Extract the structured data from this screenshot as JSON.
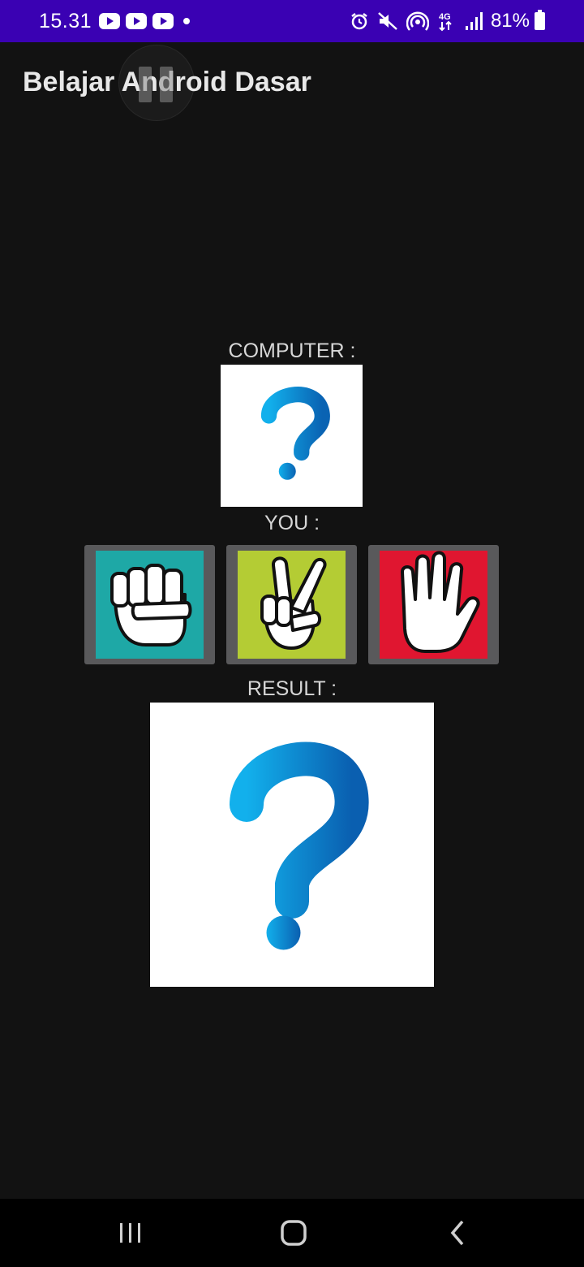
{
  "status_bar": {
    "time": "15.31",
    "notification_icons": [
      "youtube-icon",
      "youtube-icon",
      "youtube-icon"
    ],
    "network_label": "4G",
    "battery": "81%"
  },
  "app_bar": {
    "title": "Belajar Android Dasar"
  },
  "game": {
    "computer_label": "COMPUTER :",
    "computer_choice": "question-mark-icon",
    "you_label": "YOU :",
    "choices": [
      {
        "name": "rock",
        "icon": "fist-icon",
        "bg": "#1ea8a6"
      },
      {
        "name": "scissors",
        "icon": "peace-hand-icon",
        "bg": "#b4cc34"
      },
      {
        "name": "paper",
        "icon": "open-hand-icon",
        "bg": "#e01630"
      }
    ],
    "result_label": "RESULT :",
    "result_image": "question-mark-icon"
  },
  "colors": {
    "status_bar": "#3a01b3",
    "background": "#121212",
    "question_blue": "#0d8fd9",
    "choice_frame": "#59595b"
  },
  "nav_bar": {
    "buttons": [
      "recent-apps-icon",
      "home-icon",
      "back-icon"
    ]
  }
}
